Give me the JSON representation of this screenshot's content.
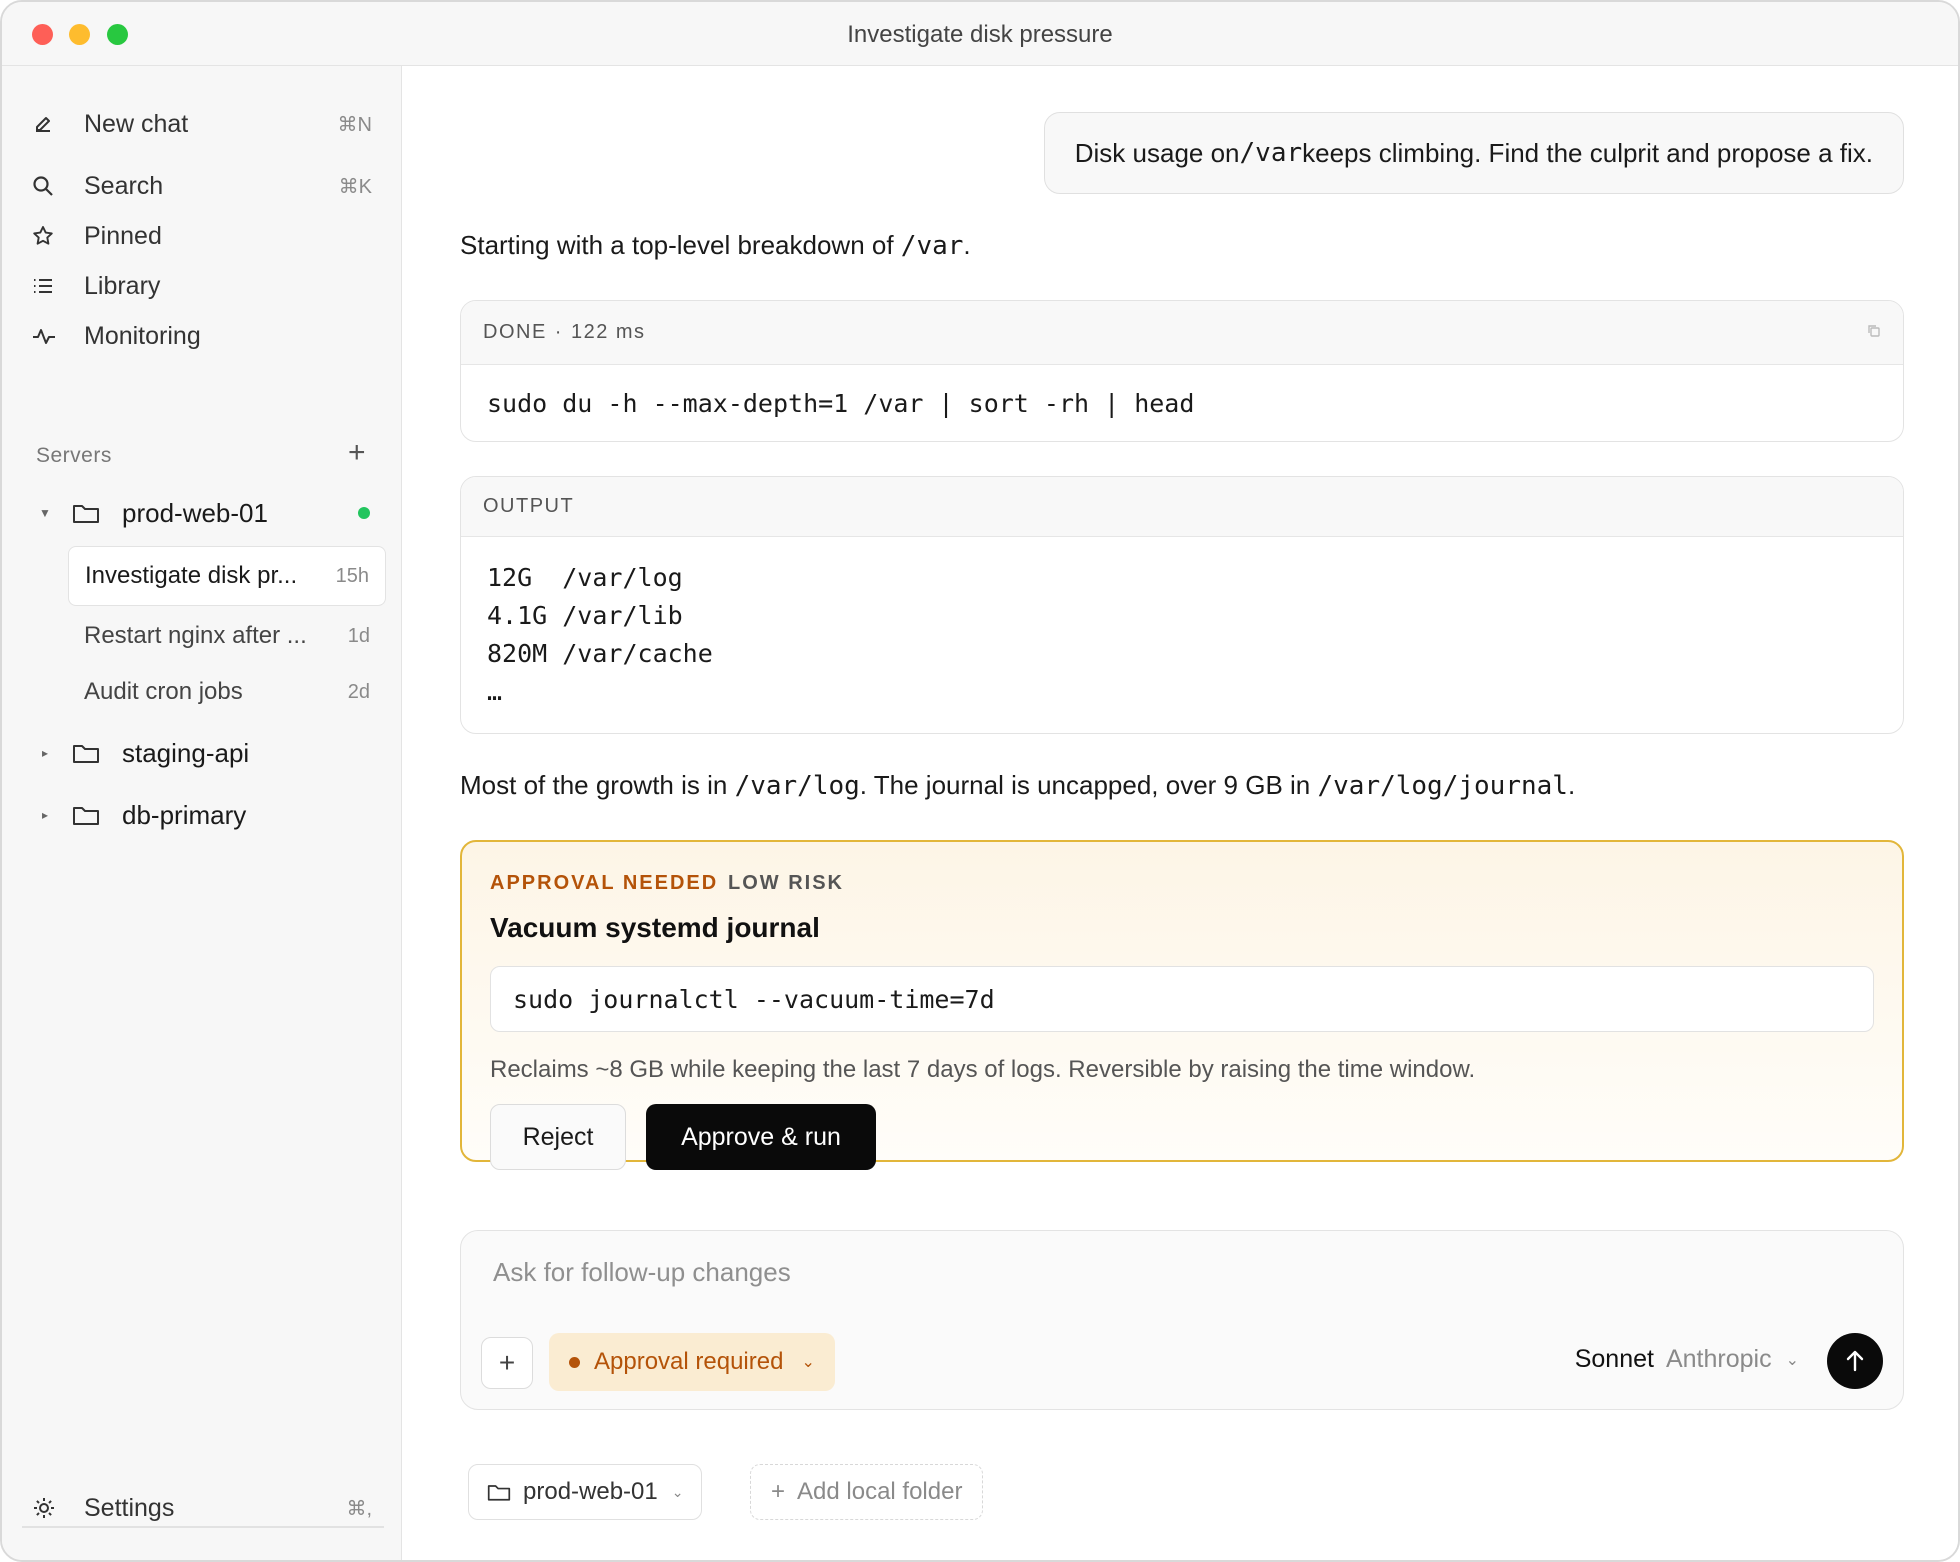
{
  "window": {
    "title": "Investigate disk pressure"
  },
  "sidebar": {
    "nav": [
      {
        "label": "New chat",
        "shortcut": "⌘N",
        "icon": "compose-icon"
      },
      {
        "label": "Search",
        "shortcut": "⌘K",
        "icon": "search-icon"
      },
      {
        "label": "Pinned",
        "shortcut": "",
        "icon": "star-icon"
      },
      {
        "label": "Library",
        "shortcut": "",
        "icon": "list-icon"
      },
      {
        "label": "Monitoring",
        "shortcut": "",
        "icon": "pulse-icon"
      }
    ],
    "section_label": "Servers",
    "servers": [
      {
        "name": "prod-web-01",
        "expanded": true,
        "online": true,
        "chats": [
          {
            "title": "Investigate disk pr...",
            "age": "15h",
            "active": true
          },
          {
            "title": "Restart nginx after ...",
            "age": "1d",
            "active": false
          },
          {
            "title": "Audit cron jobs",
            "age": "2d",
            "active": false
          }
        ]
      },
      {
        "name": "staging-api",
        "expanded": false
      },
      {
        "name": "db-primary",
        "expanded": false
      }
    ],
    "settings": {
      "label": "Settings",
      "shortcut": "⌘,"
    }
  },
  "conversation": {
    "user_message": {
      "before": "Disk usage on ",
      "code": "/var",
      "after": " keeps climbing. Find the culprit and propose a fix."
    },
    "intro": {
      "before": "Starting with a top-level breakdown of ",
      "code": "/var",
      "after": "."
    },
    "command_card": {
      "status": "DONE",
      "duration": "122 ms",
      "command": "sudo du -h --max-depth=1 /var | sort -rh | head"
    },
    "output_card": {
      "label": "OUTPUT",
      "lines": [
        "12G  /var/log",
        "4.1G /var/lib",
        "820M /var/cache",
        "…"
      ]
    },
    "analysis": {
      "p1": "Most of the growth is in ",
      "c1": "/var/log",
      "p2": ". The journal is uncapped, over 9 GB in ",
      "c2": "/var/log/journal",
      "p3": "."
    },
    "approval": {
      "tag": "APPROVAL NEEDED",
      "risk": "LOW RISK",
      "title": "Vacuum systemd journal",
      "command": "sudo journalctl --vacuum-time=7d",
      "description": "Reclaims ~8 GB while keeping the last 7 days of logs. Reversible by raising the time window.",
      "reject_label": "Reject",
      "approve_label": "Approve & run"
    }
  },
  "composer": {
    "placeholder": "Ask for follow-up changes",
    "mode": "Approval required",
    "model": "Sonnet",
    "provider": "Anthropic"
  },
  "footer": {
    "folder": "prod-web-01",
    "add_folder": "Add local folder"
  },
  "colors": {
    "accent": "#0a0a0a",
    "approval_border": "#e2b63a",
    "approval_text": "#b45309",
    "online": "#22c55e"
  }
}
